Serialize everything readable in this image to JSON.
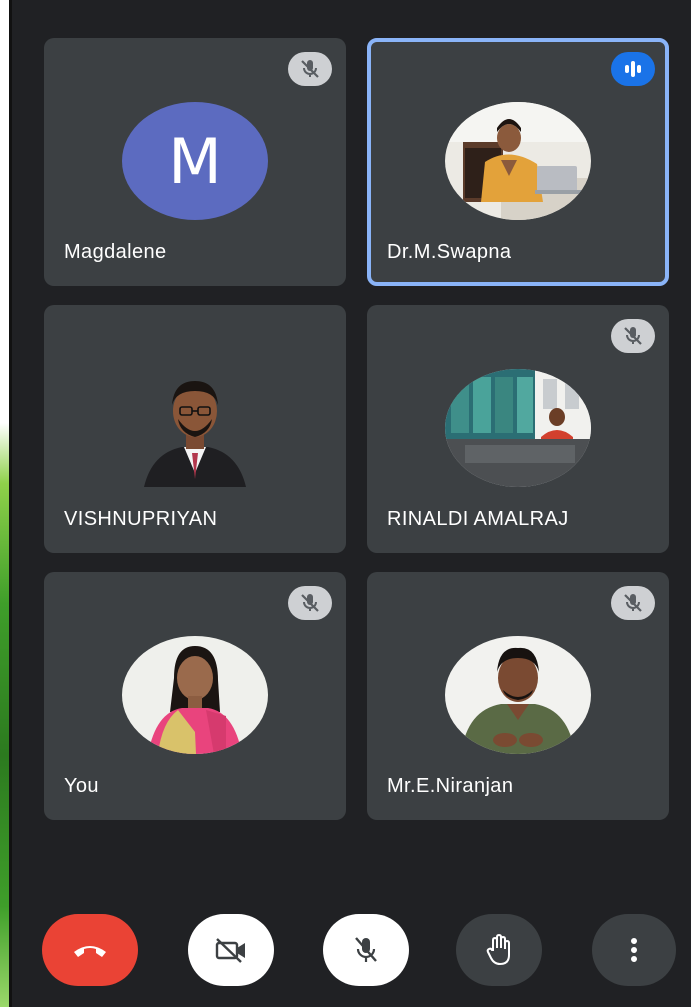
{
  "participants": [
    {
      "name": "Magdalene",
      "initial": "M",
      "muted": true,
      "speaking": false,
      "has_video": false
    },
    {
      "name": "Dr.M.Swapna",
      "muted": false,
      "speaking": true,
      "has_video": true
    },
    {
      "name": "VISHNUPRIYAN",
      "muted": false,
      "speaking": false,
      "has_video": true
    },
    {
      "name": "RINALDI AMALRAJ",
      "muted": true,
      "speaking": false,
      "has_video": true
    },
    {
      "name": "You",
      "muted": true,
      "speaking": false,
      "has_video": true
    },
    {
      "name": "Mr.E.Niranjan",
      "muted": true,
      "speaking": false,
      "has_video": true
    }
  ],
  "controls": [
    {
      "id": "end-call",
      "icon": "phone-hangup-icon"
    },
    {
      "id": "camera-off",
      "icon": "video-off-icon"
    },
    {
      "id": "mic-off",
      "icon": "mic-off-icon"
    },
    {
      "id": "raise-hand",
      "icon": "hand-icon"
    },
    {
      "id": "more-options",
      "icon": "more-vert-icon"
    }
  ],
  "colors": {
    "background": "#202124",
    "tile": "#3c4043",
    "active_outline": "#8ab4f8",
    "avatar_letter_bg": "#5c6bc0",
    "end_call": "#ea4335",
    "speaking_badge": "#1a73e8"
  }
}
